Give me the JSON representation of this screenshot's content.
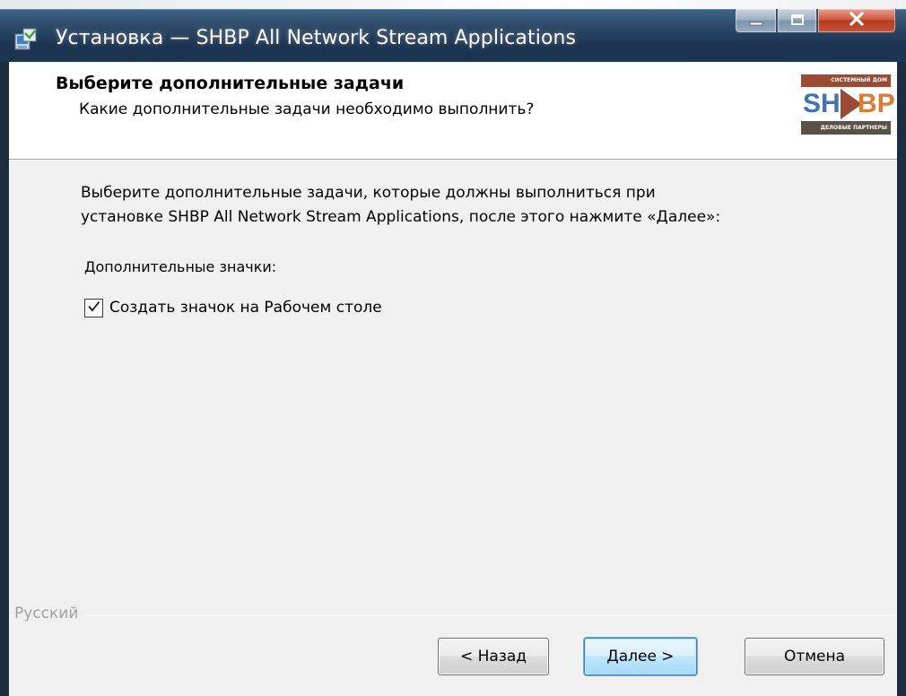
{
  "window": {
    "title": "Установка — SHBP All Network Stream Applications"
  },
  "caption_buttons": {
    "minimize_icon": "minimize-icon",
    "maximize_icon": "maximize-icon",
    "close_icon": "close-icon"
  },
  "header": {
    "title": "Выберите дополнительные задачи",
    "subtitle": "Какие дополнительные задачи необходимо выполнить?",
    "logo": {
      "top_text": "СИСТЕМНЫЙ ДОМ",
      "left_letters": "SH",
      "right_letters": "BP",
      "bottom_text": "ДЕЛОВЫЕ ПАРТНЕРЫ"
    }
  },
  "body": {
    "description_line1": "Выберите дополнительные задачи, которые должны выполниться при",
    "description_line2": "установке SHBP All Network Stream Applications, после этого нажмите «Далее»:",
    "group_label": "Дополнительные значки:",
    "checkbox": {
      "label": "Создать значок на Рабочем столе",
      "checked": true
    }
  },
  "footer": {
    "language": "Русский",
    "back_label": "< Назад",
    "next_label": "Далее >",
    "cancel_label": "Отмена"
  },
  "colors": {
    "titlebar": "#1c3452",
    "client_bg": "#f0f0f0",
    "logo_orange": "#e07a2c",
    "logo_blue": "#3d73b8",
    "logo_brown": "#9c4a31"
  }
}
